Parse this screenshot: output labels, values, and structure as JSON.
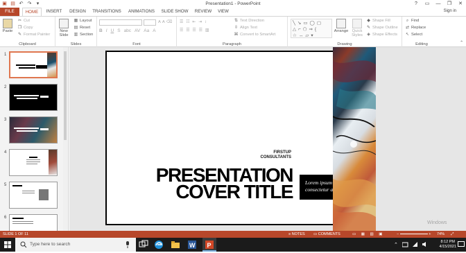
{
  "window": {
    "title": "Presentation1 - PowerPoint",
    "signin": "Sign in"
  },
  "tabs": [
    "FILE",
    "HOME",
    "INSERT",
    "DESIGN",
    "TRANSITIONS",
    "ANIMATIONS",
    "SLIDE SHOW",
    "REVIEW",
    "VIEW"
  ],
  "ribbon": {
    "clipboard": {
      "label": "Clipboard",
      "paste": "Paste",
      "cut": "Cut",
      "copy": "Copy",
      "format_painter": "Format Painter"
    },
    "slides": {
      "label": "Slides",
      "new_slide": "New Slide",
      "layout": "Layout",
      "reset": "Reset",
      "section": "Section"
    },
    "font": {
      "label": "Font"
    },
    "paragraph": {
      "label": "Paragraph",
      "text_direction": "Text Direction",
      "align_text": "Align Text",
      "convert_smartart": "Convert to SmartArt"
    },
    "drawing": {
      "label": "Drawing",
      "arrange": "Arrange",
      "quick_styles": "Quick Styles",
      "shape_fill": "Shape Fill",
      "shape_outline": "Shape Outline",
      "shape_effects": "Shape Effects"
    },
    "editing": {
      "label": "Editing",
      "find": "Find",
      "replace": "Replace",
      "select": "Select"
    }
  },
  "slide_panel": {
    "numbers": [
      "1",
      "2",
      "3",
      "4",
      "5",
      "6"
    ]
  },
  "slide": {
    "firstup_line1": "FIRSTUP",
    "firstup_line2": "CONSULTANTS",
    "title_line1": "PRESENTATION",
    "title_line2": "COVER TITLE",
    "lorem_line1": "Lorem ipsum dolor sit amet,",
    "lorem_line2": "consectetur adipiscing elit."
  },
  "watermark": "Windows",
  "statusbar": {
    "slide_info": "SLIDE 1 OF 11",
    "notes": "NOTES",
    "comments": "COMMENTS",
    "zoom": "74%"
  },
  "taskbar": {
    "search_placeholder": "Type here to search",
    "time": "8:12 PM",
    "date": "4/15/2021"
  },
  "colors": {
    "accent": "#b7472a",
    "taskbar": "#1b1b1b"
  }
}
